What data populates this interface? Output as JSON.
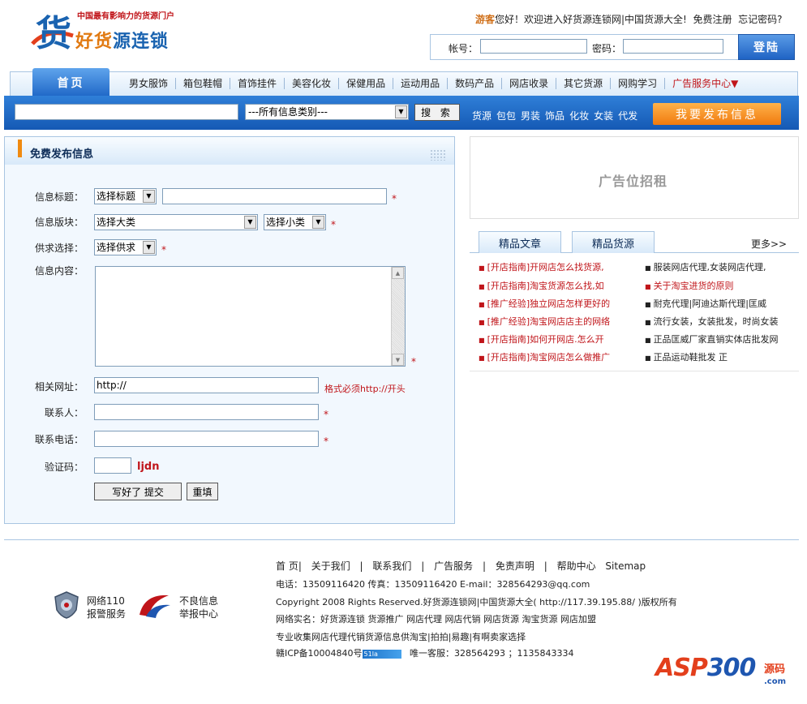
{
  "header": {
    "logo_tagline": "中国最有影响力的货源门户",
    "logo_char": "货",
    "logo_name_a": "好货",
    "logo_name_b": "源",
    "logo_name_c": "连锁",
    "greeting_user": "游客",
    "greeting_text": "您好！欢迎进入好货源连锁网|中国货源大全!",
    "register_link": "免费注册",
    "forgot_link": "忘记密码?",
    "account_label": "帐号：",
    "password_label": "密码：",
    "login_button": "登陆"
  },
  "nav": {
    "home": "首页",
    "items": [
      "男女服饰",
      "箱包鞋帽",
      "首饰挂件",
      "美容化妆",
      "保健用品",
      "运动用品",
      "数码产品",
      "网店收录",
      "其它货源",
      "网购学习"
    ],
    "ad_center": "广告服务中心"
  },
  "search": {
    "category_selected": "---所有信息类别---",
    "search_button": "搜 索",
    "hot_links": [
      "货源",
      "包包",
      "男装",
      "饰品",
      "化妆",
      "女装",
      "代发"
    ],
    "publish_button": "我要发布信息"
  },
  "form": {
    "title": "免费发布信息",
    "fields": {
      "info_title_label": "信息标题：",
      "info_title_select": "选择标题",
      "block_label": "信息版块：",
      "major_select": "选择大类",
      "minor_select": "选择小类",
      "supply_label": "供求选择：",
      "supply_select": "选择供求",
      "content_label": "信息内容：",
      "url_label": "相关网址：",
      "url_value": "http://",
      "url_hint": "格式必须http://开头",
      "contact_label": "联系人：",
      "phone_label": "联系电话：",
      "captcha_label": "验证码：",
      "captcha_code": "ljdn"
    },
    "required_mark": "*",
    "submit_button": "写好了 提交",
    "reset_button": "重填"
  },
  "sidebar": {
    "ad_placeholder": "广告位招租",
    "tab_articles": "精品文章",
    "tab_sources": "精品货源",
    "more": "更多>>",
    "articles_left": [
      "[开店指南]开网店怎么找货源,",
      "[开店指南]淘宝货源怎么找,如",
      "[推广经验]独立网店怎样更好的",
      "[推广经验]淘宝网店店主的网络",
      "[开店指南]如何开网店.怎么开",
      "[开店指南]淘宝网店怎么做推广"
    ],
    "articles_right": [
      "服装网店代理,女装网店代理,",
      "关于淘宝进货的原则",
      "耐克代理|阿迪达斯代理|匡威",
      "流行女装，女装批发，时尚女装",
      "正品匡威厂家直销实体店批发网",
      "正品运动鞋批发 正"
    ]
  },
  "footer": {
    "menu": [
      "首 页|",
      "关于我们",
      "|",
      "联系我们",
      "|",
      "广告服务",
      "|",
      "免责声明",
      "|",
      "帮助中心",
      "Sitemap"
    ],
    "contact": "电话：13509116420 传真：13509116420 E-mail：328564293@qq.com",
    "copyright": "Copyright 2008 Rights Reserved.好货源连锁网|中国货源大全( http://117.39.195.88/ )版权所有",
    "realname": "网络实名：好货源连锁 货源推广 网店代理 网店代销 网店货源 淘宝货源 网店加盟",
    "tagline": "专业收集网店代理代销货源信息供淘宝|拍拍|易趣|有啊卖家选择",
    "icp": "赣ICP备10004840号",
    "badge": "51la",
    "service": "唯一客服：328564293 ；1135843334",
    "police_line1": "网络110",
    "police_line2": "报警服务",
    "report_line1": "不良信息",
    "report_line2": "举报中心",
    "asp_a": "ASP",
    "asp_b": "300",
    "asp_cn1": "源码",
    "asp_cn2": ".com"
  },
  "colors": {
    "brand_blue": "#1e66c6",
    "accent_orange": "#f07a0e",
    "required_red": "#c0151a"
  }
}
